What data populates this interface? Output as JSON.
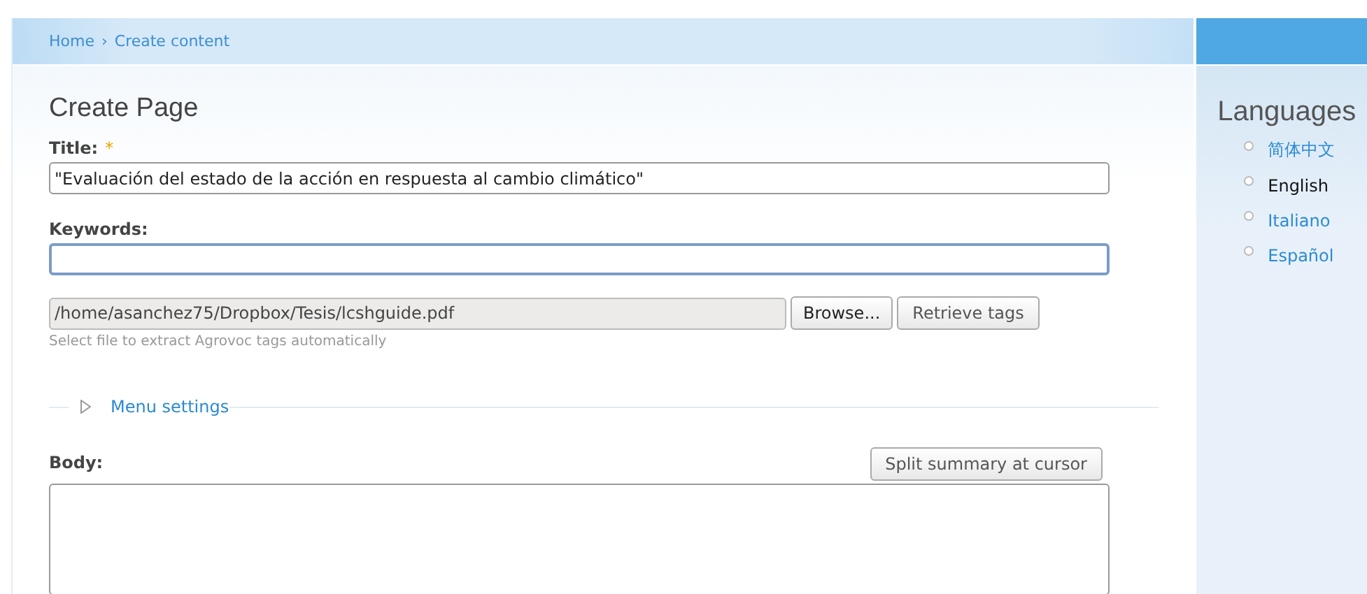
{
  "breadcrumb": [
    {
      "label": "Home"
    },
    {
      "label": "Create content"
    }
  ],
  "breadcrumb_separator": "›",
  "page_title": "Create Page",
  "title_field": {
    "label": "Title:",
    "required_mark": "*",
    "value": "\"Evaluación del estado de la acción en respuesta al cambio climático\""
  },
  "keywords_field": {
    "label": "Keywords:",
    "focused": true
  },
  "file_field": {
    "value": "/home/asanchez75/Dropbox/Tesis/lcshguide.pdf",
    "browse_button": "Browse...",
    "retrieve_button": "Retrieve tags",
    "description": "Select file to extract Agrovoc tags automatically"
  },
  "menu_settings": {
    "label": "Menu settings",
    "expanded": false
  },
  "split_button": "Split summary at cursor",
  "body_field": {
    "label": "Body:"
  },
  "sidebar": {
    "title": "Languages",
    "items": [
      {
        "label": "简体中文",
        "selected": false
      },
      {
        "label": "English",
        "selected": true
      },
      {
        "label": "Italiano",
        "selected": false
      },
      {
        "label": "Español",
        "selected": false
      }
    ]
  }
}
